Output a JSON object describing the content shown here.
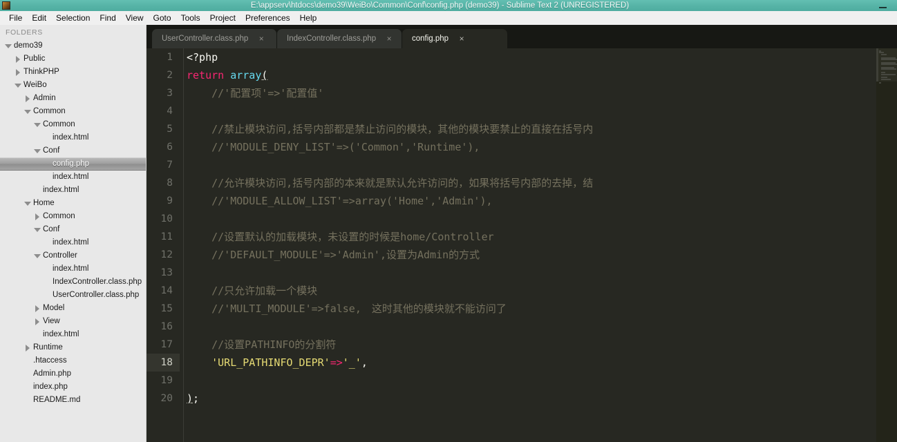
{
  "window": {
    "title": "E:\\appserv\\htdocs\\demo39\\WeiBo\\Common\\Conf\\config.php (demo39) - Sublime Text 2 (UNREGISTERED)",
    "minimize_label": "–",
    "accent_titlebar": "#56b3a6"
  },
  "menubar": {
    "items": [
      {
        "label": "File"
      },
      {
        "label": "Edit"
      },
      {
        "label": "Selection"
      },
      {
        "label": "Find"
      },
      {
        "label": "View"
      },
      {
        "label": "Goto"
      },
      {
        "label": "Tools"
      },
      {
        "label": "Project"
      },
      {
        "label": "Preferences"
      },
      {
        "label": "Help"
      }
    ]
  },
  "sidebar": {
    "header": "FOLDERS",
    "tree": [
      {
        "label": "demo39",
        "depth": 0,
        "arrow": "open",
        "selected": false
      },
      {
        "label": "Public",
        "depth": 1,
        "arrow": "closed",
        "selected": false
      },
      {
        "label": "ThinkPHP",
        "depth": 1,
        "arrow": "closed",
        "selected": false
      },
      {
        "label": "WeiBo",
        "depth": 1,
        "arrow": "open",
        "selected": false
      },
      {
        "label": "Admin",
        "depth": 2,
        "arrow": "closed",
        "selected": false
      },
      {
        "label": "Common",
        "depth": 2,
        "arrow": "open",
        "selected": false
      },
      {
        "label": "Common",
        "depth": 3,
        "arrow": "open",
        "selected": false
      },
      {
        "label": "index.html",
        "depth": 4,
        "arrow": "none",
        "selected": false
      },
      {
        "label": "Conf",
        "depth": 3,
        "arrow": "open",
        "selected": false
      },
      {
        "label": "config.php",
        "depth": 4,
        "arrow": "none",
        "selected": true
      },
      {
        "label": "index.html",
        "depth": 4,
        "arrow": "none",
        "selected": false
      },
      {
        "label": "index.html",
        "depth": 3,
        "arrow": "none",
        "selected": false
      },
      {
        "label": "Home",
        "depth": 2,
        "arrow": "open",
        "selected": false
      },
      {
        "label": "Common",
        "depth": 3,
        "arrow": "closed",
        "selected": false
      },
      {
        "label": "Conf",
        "depth": 3,
        "arrow": "open",
        "selected": false
      },
      {
        "label": "index.html",
        "depth": 4,
        "arrow": "none",
        "selected": false
      },
      {
        "label": "Controller",
        "depth": 3,
        "arrow": "open",
        "selected": false
      },
      {
        "label": "index.html",
        "depth": 4,
        "arrow": "none",
        "selected": false
      },
      {
        "label": "IndexController.class.php",
        "depth": 4,
        "arrow": "none",
        "selected": false
      },
      {
        "label": "UserController.class.php",
        "depth": 4,
        "arrow": "none",
        "selected": false
      },
      {
        "label": "Model",
        "depth": 3,
        "arrow": "closed",
        "selected": false
      },
      {
        "label": "View",
        "depth": 3,
        "arrow": "closed",
        "selected": false
      },
      {
        "label": "index.html",
        "depth": 3,
        "arrow": "none",
        "selected": false
      },
      {
        "label": "Runtime",
        "depth": 2,
        "arrow": "closed",
        "selected": false
      },
      {
        "label": ".htaccess",
        "depth": 2,
        "arrow": "none",
        "selected": false
      },
      {
        "label": "Admin.php",
        "depth": 2,
        "arrow": "none",
        "selected": false
      },
      {
        "label": "index.php",
        "depth": 2,
        "arrow": "none",
        "selected": false
      },
      {
        "label": "README.md",
        "depth": 2,
        "arrow": "none",
        "selected": false
      }
    ]
  },
  "tabs": {
    "close_glyph": "×",
    "items": [
      {
        "label": "UserController.class.php",
        "active": false
      },
      {
        "label": "IndexController.class.php",
        "active": false
      },
      {
        "label": "config.php",
        "active": true
      }
    ]
  },
  "editor": {
    "current_line": 18,
    "line_numbers": [
      1,
      2,
      3,
      4,
      5,
      6,
      7,
      8,
      9,
      10,
      11,
      12,
      13,
      14,
      15,
      16,
      17,
      18,
      19,
      20
    ],
    "lines": [
      {
        "n": 1,
        "text": "<?php"
      },
      {
        "n": 2,
        "text": "return array("
      },
      {
        "n": 3,
        "text": "    //'配置项'=>'配置值'"
      },
      {
        "n": 4,
        "text": ""
      },
      {
        "n": 5,
        "text": "    //禁止模块访问,括号内部都是禁止访问的模块，其他的模块要禁止的直接在括号内"
      },
      {
        "n": 6,
        "text": "    //'MODULE_DENY_LIST'=>('Common','Runtime'),"
      },
      {
        "n": 7,
        "text": ""
      },
      {
        "n": 8,
        "text": "    //允许模块访问,括号内部的本来就是默认允许访问的，如果将括号内部的去掉，结"
      },
      {
        "n": 9,
        "text": "    //'MODULE_ALLOW_LIST'=>array('Home','Admin'),"
      },
      {
        "n": 10,
        "text": ""
      },
      {
        "n": 11,
        "text": "    //设置默认的加载模块，未设置的时候是home/Controller"
      },
      {
        "n": 12,
        "text": "    //'DEFAULT_MODULE'=>'Admin',设置为Admin的方式"
      },
      {
        "n": 13,
        "text": ""
      },
      {
        "n": 14,
        "text": "    //只允许加载一个模块"
      },
      {
        "n": 15,
        "text": "    //'MULTI_MODULE'=>false,　这时其他的模块就不能访问了"
      },
      {
        "n": 16,
        "text": ""
      },
      {
        "n": 17,
        "text": "    //设置PATHINFO的分割符"
      },
      {
        "n": 18,
        "text": "    'URL_PATHINFO_DEPR'=>'_',"
      },
      {
        "n": 19,
        "text": ""
      },
      {
        "n": 20,
        "text": ");"
      }
    ],
    "colors": {
      "background": "#272822",
      "foreground": "#f8f8f2",
      "comment": "#75715e",
      "keyword": "#f92672",
      "function": "#66d9ef",
      "string": "#e6db74",
      "gutter_text": "#70716a"
    }
  }
}
